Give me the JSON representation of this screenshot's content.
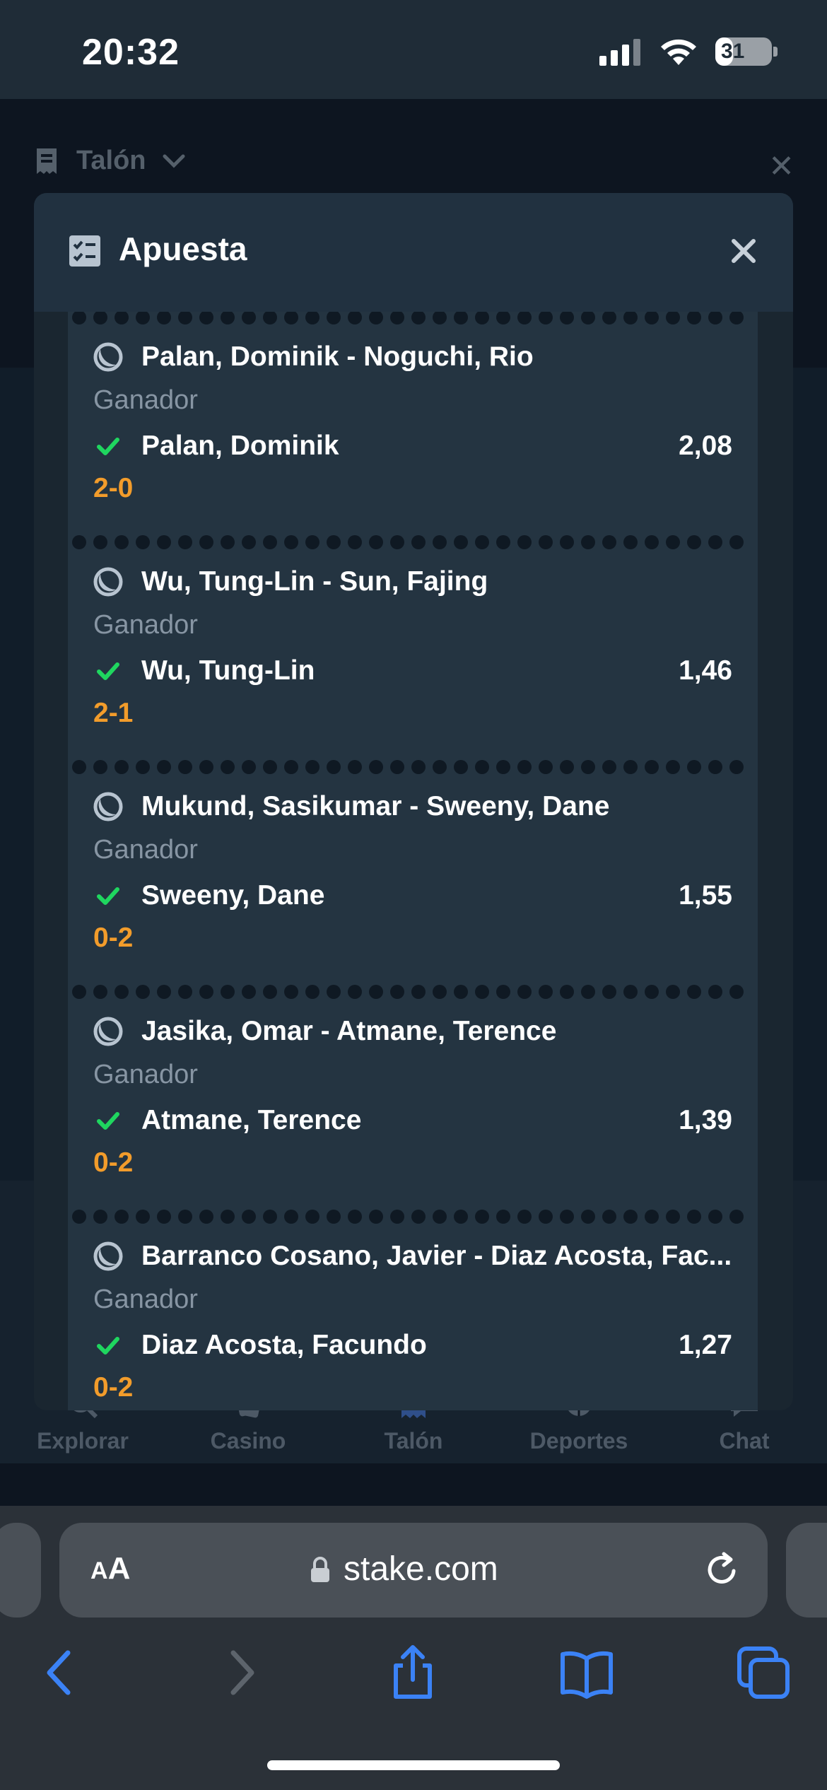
{
  "status_bar": {
    "time": "20:32",
    "battery": "31",
    "battery_level": 0.31
  },
  "background": {
    "header_label": "Talón",
    "nav": [
      {
        "label": "Explorar",
        "icon": "search-icon"
      },
      {
        "label": "Casino",
        "icon": "cards-icon"
      },
      {
        "label": "Talón",
        "icon": "betslip-icon"
      },
      {
        "label": "Deportes",
        "icon": "ball-icon"
      },
      {
        "label": "Chat",
        "icon": "chat-icon"
      }
    ]
  },
  "modal": {
    "title": "Apuesta",
    "selections": [
      {
        "event": "Palan, Dominik - Noguchi, Rio",
        "market": "Ganador",
        "pick": "Palan, Dominik",
        "odds": "2,08",
        "score": "2-0"
      },
      {
        "event": "Wu, Tung-Lin - Sun, Fajing",
        "market": "Ganador",
        "pick": "Wu, Tung-Lin",
        "odds": "1,46",
        "score": "2-1"
      },
      {
        "event": "Mukund, Sasikumar - Sweeny, Dane",
        "market": "Ganador",
        "pick": "Sweeny, Dane",
        "odds": "1,55",
        "score": "0-2"
      },
      {
        "event": "Jasika, Omar - Atmane, Terence",
        "market": "Ganador",
        "pick": "Atmane, Terence",
        "odds": "1,39",
        "score": "0-2"
      },
      {
        "event": "Barranco Cosano, Javier - Diaz Acosta, Fac...",
        "market": "Ganador",
        "pick": "Diaz Acosta, Facundo",
        "odds": "1,27",
        "score": "0-2"
      }
    ]
  },
  "browser": {
    "aa": "AA",
    "url": "stake.com"
  },
  "colors": {
    "score": "#f29c2b",
    "check": "#1fd65f",
    "accent": "#3b82f6"
  }
}
